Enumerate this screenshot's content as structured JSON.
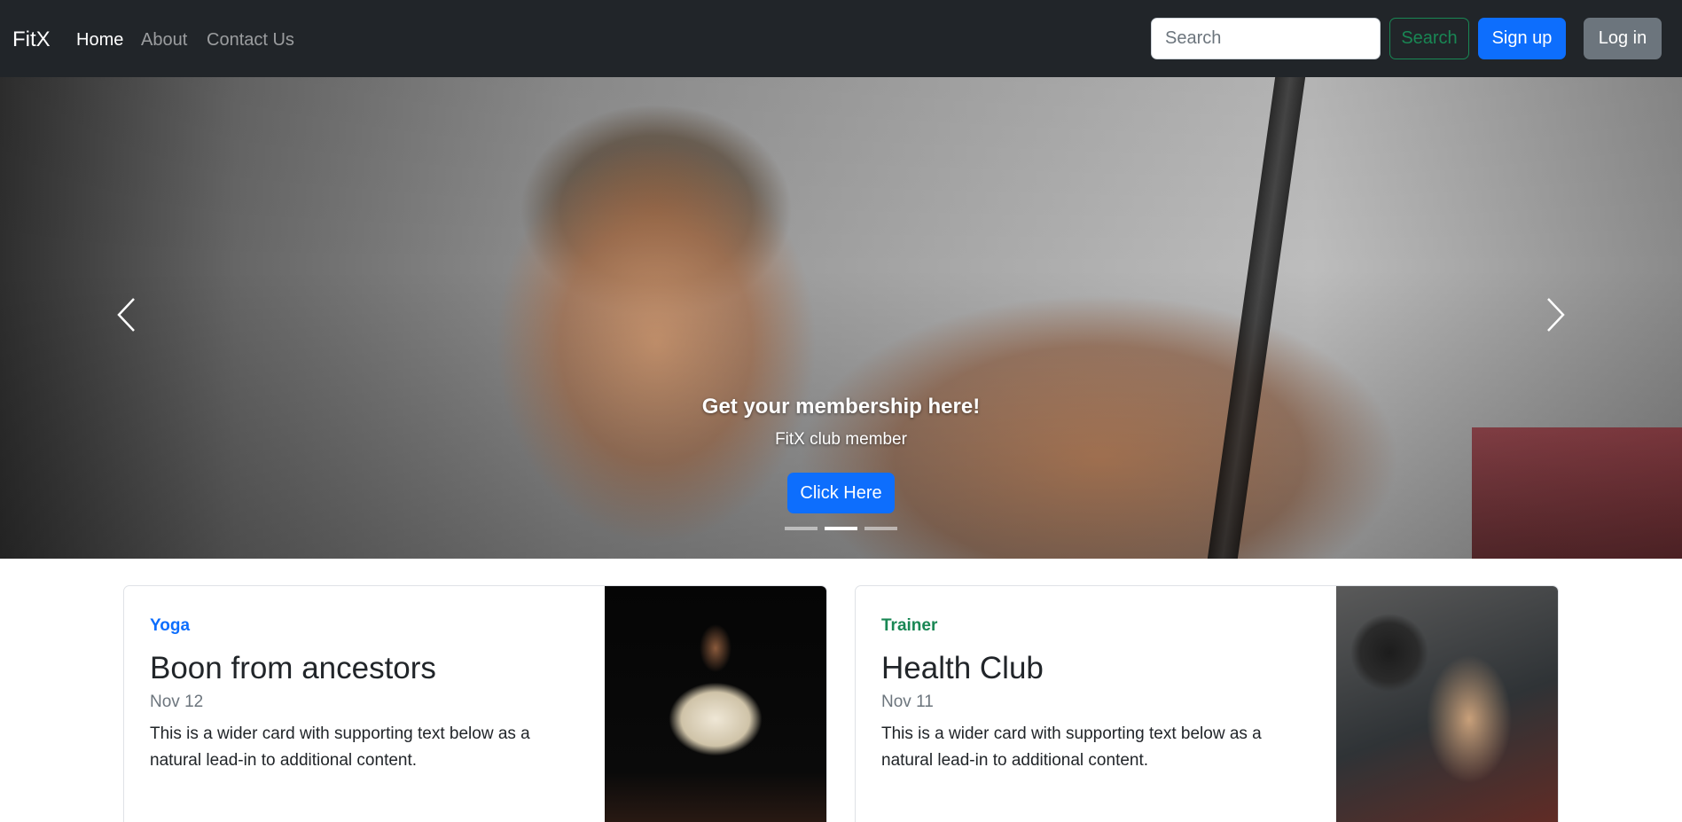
{
  "navbar": {
    "brand": "FitX",
    "links": [
      {
        "label": "Home",
        "active": true
      },
      {
        "label": "About",
        "active": false
      },
      {
        "label": "Contact Us",
        "active": false
      }
    ],
    "search_placeholder": "Search",
    "search_button": "Search",
    "signup_button": "Sign up",
    "login_button": "Log in"
  },
  "hero": {
    "caption_title": "Get your membership here!",
    "caption_subtitle": "FitX club member",
    "cta_label": "Click Here",
    "prev_icon": "chevron-left-icon",
    "next_icon": "chevron-right-icon",
    "slide_count": 3,
    "active_slide": 2
  },
  "cards": [
    {
      "category": "Yoga",
      "category_color": "#0d6efd",
      "title": "Boon from ancestors",
      "date": "Nov 12",
      "text": "This is a wider card with supporting text below as a natural lead-in to additional content."
    },
    {
      "category": "Trainer",
      "category_color": "#198754",
      "title": "Health Club",
      "date": "Nov 11",
      "text": "This is a wider card with supporting text below as a natural lead-in to additional content."
    }
  ]
}
